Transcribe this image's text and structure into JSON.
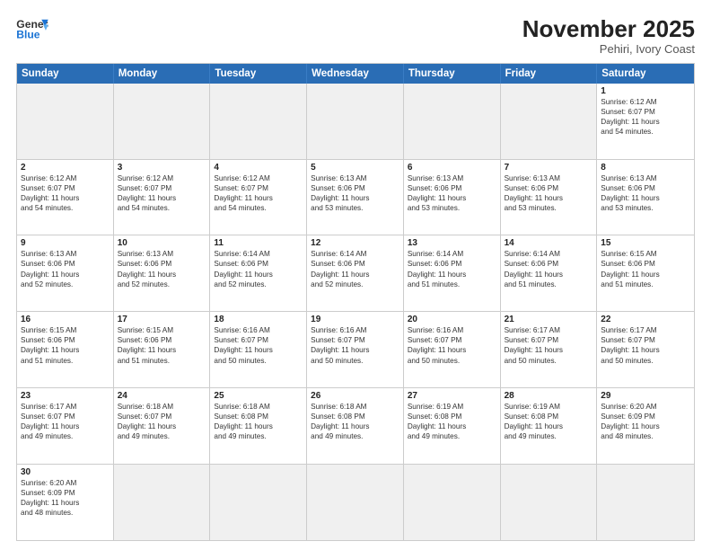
{
  "header": {
    "logo_general": "General",
    "logo_blue": "Blue",
    "month_title": "November 2025",
    "subtitle": "Pehiri, Ivory Coast"
  },
  "days_of_week": [
    "Sunday",
    "Monday",
    "Tuesday",
    "Wednesday",
    "Thursday",
    "Friday",
    "Saturday"
  ],
  "weeks": [
    {
      "cells": [
        {
          "day": null,
          "empty": true
        },
        {
          "day": null,
          "empty": true
        },
        {
          "day": null,
          "empty": true
        },
        {
          "day": null,
          "empty": true
        },
        {
          "day": null,
          "empty": true
        },
        {
          "day": null,
          "empty": true
        },
        {
          "day": "1",
          "sunrise": "6:12 AM",
          "sunset": "6:07 PM",
          "daylight_h": "11 hours",
          "daylight_m": "and 54 minutes."
        }
      ]
    },
    {
      "cells": [
        {
          "day": "2",
          "sunrise": "6:12 AM",
          "sunset": "6:07 PM",
          "daylight_h": "11 hours",
          "daylight_m": "and 54 minutes."
        },
        {
          "day": "3",
          "sunrise": "6:12 AM",
          "sunset": "6:07 PM",
          "daylight_h": "11 hours",
          "daylight_m": "and 54 minutes."
        },
        {
          "day": "4",
          "sunrise": "6:12 AM",
          "sunset": "6:07 PM",
          "daylight_h": "11 hours",
          "daylight_m": "and 54 minutes."
        },
        {
          "day": "5",
          "sunrise": "6:13 AM",
          "sunset": "6:06 PM",
          "daylight_h": "11 hours",
          "daylight_m": "and 53 minutes."
        },
        {
          "day": "6",
          "sunrise": "6:13 AM",
          "sunset": "6:06 PM",
          "daylight_h": "11 hours",
          "daylight_m": "and 53 minutes."
        },
        {
          "day": "7",
          "sunrise": "6:13 AM",
          "sunset": "6:06 PM",
          "daylight_h": "11 hours",
          "daylight_m": "and 53 minutes."
        },
        {
          "day": "8",
          "sunrise": "6:13 AM",
          "sunset": "6:06 PM",
          "daylight_h": "11 hours",
          "daylight_m": "and 53 minutes."
        }
      ]
    },
    {
      "cells": [
        {
          "day": "9",
          "sunrise": "6:13 AM",
          "sunset": "6:06 PM",
          "daylight_h": "11 hours",
          "daylight_m": "and 52 minutes."
        },
        {
          "day": "10",
          "sunrise": "6:13 AM",
          "sunset": "6:06 PM",
          "daylight_h": "11 hours",
          "daylight_m": "and 52 minutes."
        },
        {
          "day": "11",
          "sunrise": "6:14 AM",
          "sunset": "6:06 PM",
          "daylight_h": "11 hours",
          "daylight_m": "and 52 minutes."
        },
        {
          "day": "12",
          "sunrise": "6:14 AM",
          "sunset": "6:06 PM",
          "daylight_h": "11 hours",
          "daylight_m": "and 52 minutes."
        },
        {
          "day": "13",
          "sunrise": "6:14 AM",
          "sunset": "6:06 PM",
          "daylight_h": "11 hours",
          "daylight_m": "and 51 minutes."
        },
        {
          "day": "14",
          "sunrise": "6:14 AM",
          "sunset": "6:06 PM",
          "daylight_h": "11 hours",
          "daylight_m": "and 51 minutes."
        },
        {
          "day": "15",
          "sunrise": "6:15 AM",
          "sunset": "6:06 PM",
          "daylight_h": "11 hours",
          "daylight_m": "and 51 minutes."
        }
      ]
    },
    {
      "cells": [
        {
          "day": "16",
          "sunrise": "6:15 AM",
          "sunset": "6:06 PM",
          "daylight_h": "11 hours",
          "daylight_m": "and 51 minutes."
        },
        {
          "day": "17",
          "sunrise": "6:15 AM",
          "sunset": "6:06 PM",
          "daylight_h": "11 hours",
          "daylight_m": "and 51 minutes."
        },
        {
          "day": "18",
          "sunrise": "6:16 AM",
          "sunset": "6:07 PM",
          "daylight_h": "11 hours",
          "daylight_m": "and 50 minutes."
        },
        {
          "day": "19",
          "sunrise": "6:16 AM",
          "sunset": "6:07 PM",
          "daylight_h": "11 hours",
          "daylight_m": "and 50 minutes."
        },
        {
          "day": "20",
          "sunrise": "6:16 AM",
          "sunset": "6:07 PM",
          "daylight_h": "11 hours",
          "daylight_m": "and 50 minutes."
        },
        {
          "day": "21",
          "sunrise": "6:17 AM",
          "sunset": "6:07 PM",
          "daylight_h": "11 hours",
          "daylight_m": "and 50 minutes."
        },
        {
          "day": "22",
          "sunrise": "6:17 AM",
          "sunset": "6:07 PM",
          "daylight_h": "11 hours",
          "daylight_m": "and 50 minutes."
        }
      ]
    },
    {
      "cells": [
        {
          "day": "23",
          "sunrise": "6:17 AM",
          "sunset": "6:07 PM",
          "daylight_h": "11 hours",
          "daylight_m": "and 49 minutes."
        },
        {
          "day": "24",
          "sunrise": "6:18 AM",
          "sunset": "6:07 PM",
          "daylight_h": "11 hours",
          "daylight_m": "and 49 minutes."
        },
        {
          "day": "25",
          "sunrise": "6:18 AM",
          "sunset": "6:08 PM",
          "daylight_h": "11 hours",
          "daylight_m": "and 49 minutes."
        },
        {
          "day": "26",
          "sunrise": "6:18 AM",
          "sunset": "6:08 PM",
          "daylight_h": "11 hours",
          "daylight_m": "and 49 minutes."
        },
        {
          "day": "27",
          "sunrise": "6:19 AM",
          "sunset": "6:08 PM",
          "daylight_h": "11 hours",
          "daylight_m": "and 49 minutes."
        },
        {
          "day": "28",
          "sunrise": "6:19 AM",
          "sunset": "6:08 PM",
          "daylight_h": "11 hours",
          "daylight_m": "and 49 minutes."
        },
        {
          "day": "29",
          "sunrise": "6:20 AM",
          "sunset": "6:09 PM",
          "daylight_h": "11 hours",
          "daylight_m": "and 48 minutes."
        }
      ]
    },
    {
      "cells": [
        {
          "day": "30",
          "sunrise": "6:20 AM",
          "sunset": "6:09 PM",
          "daylight_h": "11 hours",
          "daylight_m": "and 48 minutes."
        },
        {
          "day": null,
          "empty": true
        },
        {
          "day": null,
          "empty": true
        },
        {
          "day": null,
          "empty": true
        },
        {
          "day": null,
          "empty": true
        },
        {
          "day": null,
          "empty": true
        },
        {
          "day": null,
          "empty": true
        }
      ]
    }
  ],
  "labels": {
    "sunrise": "Sunrise:",
    "sunset": "Sunset:",
    "daylight": "Daylight:"
  }
}
